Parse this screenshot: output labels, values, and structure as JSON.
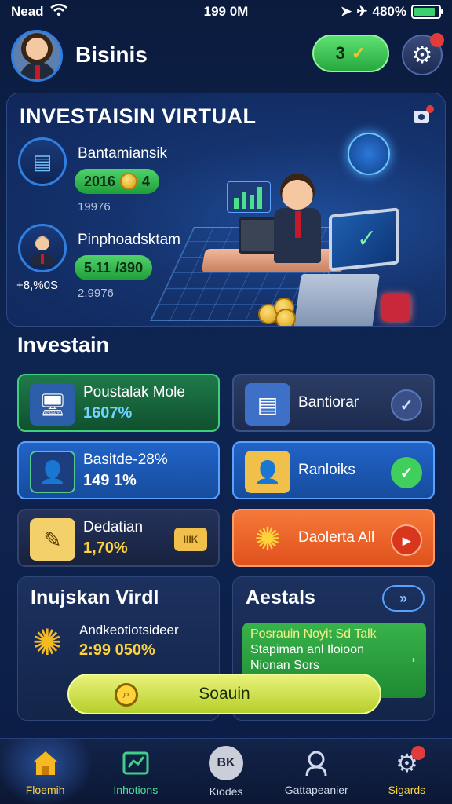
{
  "status_bar": {
    "carrier": "Nead",
    "time": "199 0M",
    "battery": "480%",
    "battery_level": 0.85
  },
  "header": {
    "title": "Bisinis",
    "coins": "3",
    "settings_badge": ""
  },
  "hero": {
    "title": "INVESTAISIN VIRTUAL",
    "stats": [
      {
        "label": "Bantamiansik",
        "pill_left": "2016",
        "pill_right": "4",
        "sub": "19976",
        "extra": ""
      },
      {
        "label": "Pinphoadsktam",
        "pill_left": "5.11",
        "pill_right": "/390",
        "sub": "2.9976",
        "extra": "+8,%0S"
      }
    ]
  },
  "investasi": {
    "title": "Investain",
    "tiles": [
      {
        "title": "Poustalak Mole",
        "value": "1607%",
        "color": "#3fcf7a"
      },
      {
        "title": "Bantiorar",
        "value": "",
        "color": "#3a5288"
      },
      {
        "title": "Basitde-28%",
        "value": "149 1%",
        "color": "#5aa0ff"
      },
      {
        "title": "Ranloiks",
        "value": "",
        "color": "#5aa0ff"
      },
      {
        "title": "Dedatian",
        "value": "1,70%",
        "color": "#33436c"
      },
      {
        "title": "Daolerta All",
        "value": "",
        "color": "#ff9d6a"
      }
    ],
    "tile_badge_text": "IIIK"
  },
  "lower_left": {
    "title": "Inujskan Virdl",
    "item_label": "Andkeotiotsideer",
    "item_value": "2:99 050%"
  },
  "lower_right": {
    "title": "Aestals",
    "card_lines": [
      "Posrauin Noyit Sd Talk",
      "Stapiman anl Iloioon",
      "Nionan Sors"
    ]
  },
  "search": {
    "label": "Soauin"
  },
  "bottom_nav": [
    {
      "label": "Floemih",
      "icon": "home-icon"
    },
    {
      "label": "Inhotions",
      "icon": "chart-icon"
    },
    {
      "label": "Kiodes",
      "icon": "bk-icon",
      "icon_text": "BK"
    },
    {
      "label": "Gattapeanier",
      "icon": "profile-icon"
    },
    {
      "label": "Sigards",
      "icon": "gear-icon"
    }
  ]
}
